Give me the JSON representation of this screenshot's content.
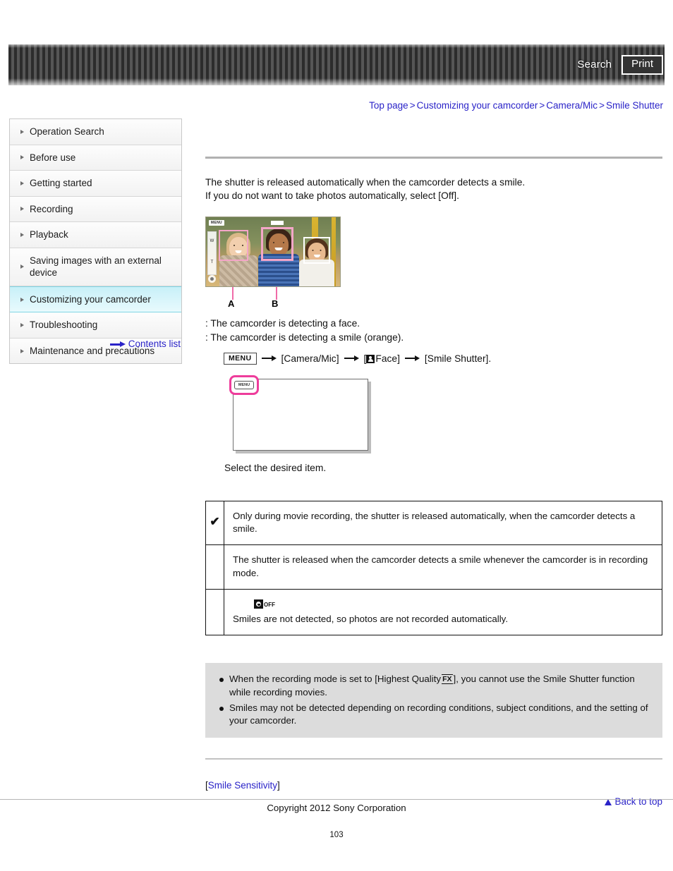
{
  "header": {
    "search_label": "Search",
    "print_label": "Print"
  },
  "breadcrumb": {
    "items": [
      {
        "label": "Top page"
      },
      {
        "label": "Customizing your camcorder"
      },
      {
        "label": "Camera/Mic"
      },
      {
        "label": "Smile Shutter"
      }
    ],
    "separator": ">"
  },
  "sidebar": {
    "items": [
      {
        "label": "Operation Search",
        "active": false
      },
      {
        "label": "Before use",
        "active": false
      },
      {
        "label": "Getting started",
        "active": false
      },
      {
        "label": "Recording",
        "active": false
      },
      {
        "label": "Playback",
        "active": false
      },
      {
        "label": "Saving images with an external device",
        "active": false
      },
      {
        "label": "Customizing your camcorder",
        "active": true
      },
      {
        "label": "Troubleshooting",
        "active": false
      },
      {
        "label": "Maintenance and precautions",
        "active": false
      }
    ],
    "contents_list_label": "Contents list"
  },
  "main": {
    "intro_line1": "The shutter is released automatically when the camcorder detects a smile.",
    "intro_line2": "If you do not want to take photos automatically, select [Off].",
    "figure": {
      "callout_a": "A",
      "callout_b": "B",
      "menu_chip": "MENU",
      "zoom_w": "W",
      "zoom_t": "T"
    },
    "legend": {
      "line_a": ": The camcorder is detecting a face.",
      "line_b": ": The camcorder is detecting a smile (orange)."
    },
    "menu_path": {
      "menu_button": "MENU",
      "step1": "[Camera/Mic]",
      "step2_prefix": "[",
      "step2": "Face]",
      "step3": "[Smile Shutter]."
    },
    "lcd_diagram": {
      "menu_chip": "MENU"
    },
    "select_note": "Select the desired item.",
    "options_table": {
      "rows": [
        {
          "mark": "✔",
          "icon": "",
          "text": "Only during movie recording, the shutter is released automatically, when the camcorder detects a smile."
        },
        {
          "mark": "",
          "icon": "",
          "text": "The shutter is released when the camcorder detects a smile whenever the camcorder is in recording mode."
        },
        {
          "mark": "",
          "icon": "smile-off-icon",
          "icon_off_label": "OFF",
          "text": "Smiles are not detected, so photos are not recorded automatically."
        }
      ]
    },
    "notes": [
      {
        "part1": "When the recording mode is set to [Highest Quality",
        "icon": "FX",
        "part2": "], you cannot use the Smile Shutter function while recording movies."
      },
      {
        "part1": "Smiles may not be detected depending on recording conditions, subject conditions, and the setting of your camcorder.",
        "icon": "",
        "part2": ""
      }
    ],
    "related_link": {
      "open_bracket": "[",
      "label": "Smile Sensitivity",
      "close_bracket": "]"
    },
    "back_to_top": "Back to top"
  },
  "footer": {
    "copyright": "Copyright 2012 Sony Corporation",
    "page_number": "103"
  },
  "colors": {
    "link": "#2a23c8",
    "sidebar_active": "#c8f0f8",
    "highlight_magenta": "#ee3c9b",
    "smile_frame_pink": "#f4a6c8",
    "notes_bg": "#dcdcdc"
  }
}
